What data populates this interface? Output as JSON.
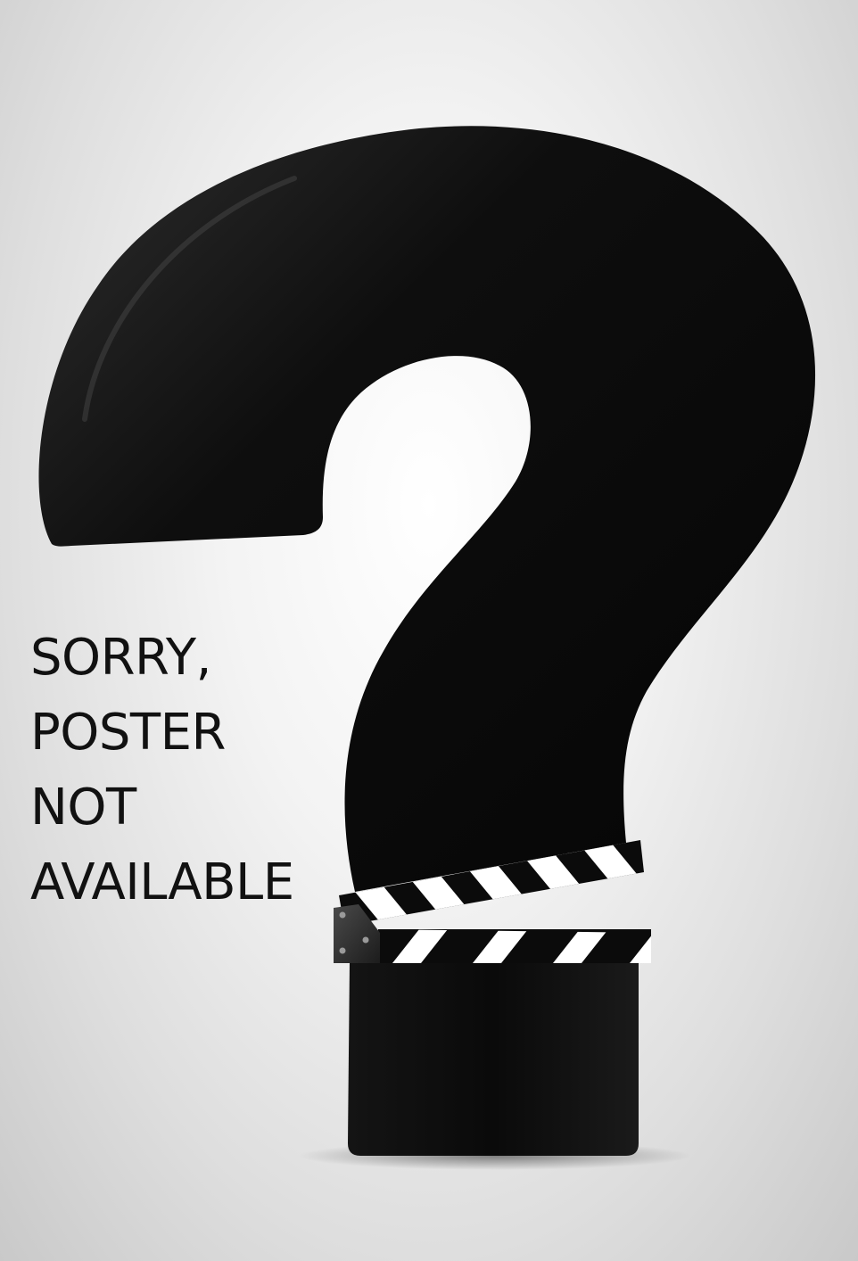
{
  "poster": {
    "message_lines": [
      "SORRY,",
      "POSTER",
      "NOT",
      "AVAILABLE"
    ]
  },
  "icons": {
    "main": "question-mark-icon",
    "base": "clapperboard-icon"
  },
  "colors": {
    "background": "#f0f0f0",
    "shape": "#0c0c0c",
    "stripe_light": "#ffffff",
    "text": "#111111"
  }
}
